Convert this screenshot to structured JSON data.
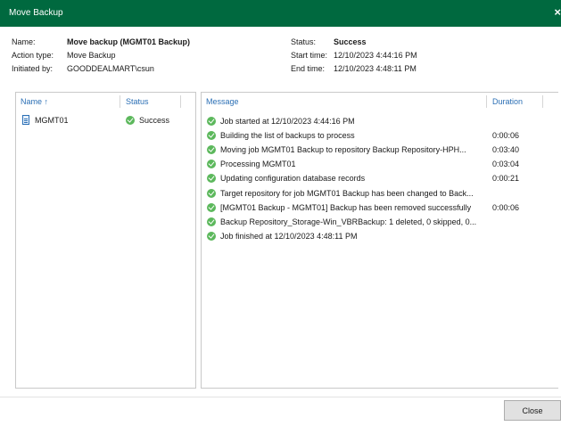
{
  "window": {
    "title": "Move Backup",
    "close_glyph": "×"
  },
  "summary": {
    "name_label": "Name:",
    "name_value": "Move backup (MGMT01 Backup)",
    "action_label": "Action type:",
    "action_value": "Move Backup",
    "initiated_label": "Initiated by:",
    "initiated_value": "GOODDEALMART\\csun",
    "status_label": "Status:",
    "status_value": "Success",
    "start_label": "Start time:",
    "start_value": "12/10/2023 4:44:16 PM",
    "end_label": "End time:",
    "end_value": "12/10/2023 4:48:11 PM"
  },
  "objects": {
    "columns": {
      "name": "Name",
      "sort_arrow": "↑",
      "status": "Status"
    },
    "rows": [
      {
        "name": "MGMT01",
        "status": "Success",
        "icon": "document-icon"
      }
    ]
  },
  "log": {
    "columns": {
      "message": "Message",
      "duration": "Duration"
    },
    "rows": [
      {
        "message": "Job started at 12/10/2023 4:44:16 PM",
        "duration": ""
      },
      {
        "message": "Building the list of backups to process",
        "duration": "0:00:06"
      },
      {
        "message": "Moving job MGMT01 Backup to repository Backup Repository-HPH...",
        "duration": "0:03:40"
      },
      {
        "message": "Processing MGMT01",
        "duration": "0:03:04"
      },
      {
        "message": "Updating configuration database records",
        "duration": "0:00:21"
      },
      {
        "message": "Target repository for job MGMT01 Backup has been changed to Back...",
        "duration": ""
      },
      {
        "message": "[MGMT01 Backup - MGMT01] Backup has been removed successfully",
        "duration": "0:00:06"
      },
      {
        "message": "Backup Repository_Storage-Win_VBRBackup: 1 deleted, 0 skipped, 0...",
        "duration": ""
      },
      {
        "message": "Job finished at 12/10/2023 4:48:11 PM",
        "duration": ""
      }
    ]
  },
  "footer": {
    "close_label": "Close"
  },
  "colors": {
    "titlebar": "#00693f",
    "header_text": "#2b6fb5",
    "success": "#5cb85c"
  }
}
